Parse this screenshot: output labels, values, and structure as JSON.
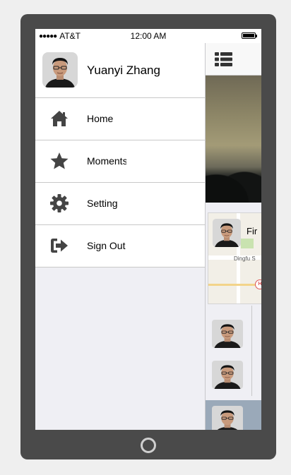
{
  "status_bar": {
    "carrier": "AT&T",
    "time": "12:00 AM"
  },
  "drawer": {
    "user_name": "Yuanyi Zhang",
    "menu": [
      {
        "label": "Home",
        "icon": "home-icon"
      },
      {
        "label": "Moments",
        "icon": "star-icon"
      },
      {
        "label": "Setting",
        "icon": "gear-icon"
      },
      {
        "label": "Sign Out",
        "icon": "sign-out-icon"
      }
    ]
  },
  "background_app": {
    "card_name": "Fir",
    "map_label": "Dingfu S",
    "hospital_marker": "H"
  },
  "colors": {
    "phone_frame": "#4a4a4a",
    "drawer_bg": "#efeff4",
    "icon": "#444444"
  }
}
